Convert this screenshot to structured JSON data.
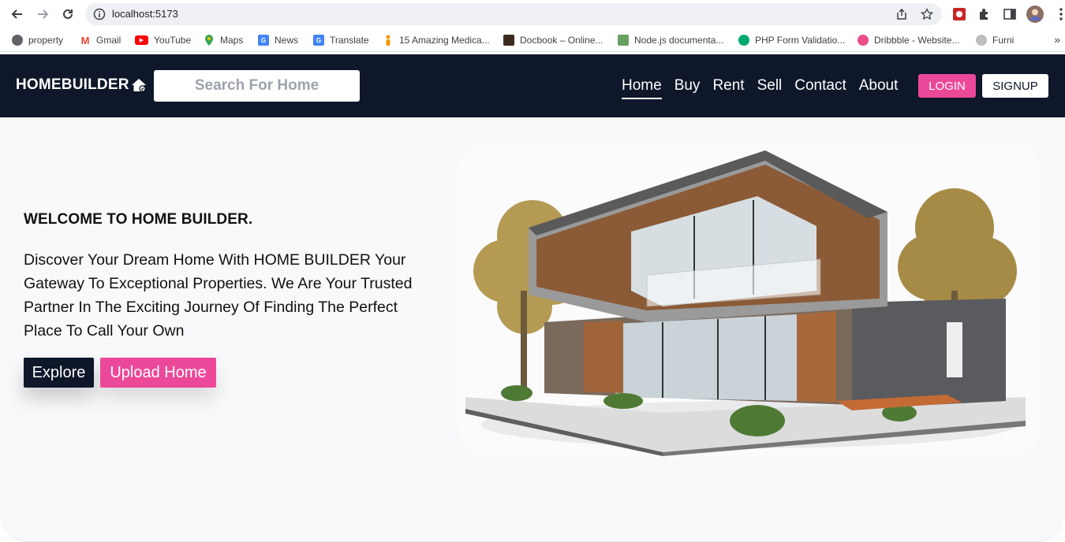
{
  "browser": {
    "url": "localhost:5173",
    "bookmarks": [
      {
        "label": "property",
        "icon": "globe-icon",
        "color": "#5f6368"
      },
      {
        "label": "Gmail",
        "icon": "gmail-icon",
        "color": "#ea4335"
      },
      {
        "label": "YouTube",
        "icon": "youtube-icon",
        "color": "#ff0000"
      },
      {
        "label": "Maps",
        "icon": "maps-icon",
        "color": "#34a853"
      },
      {
        "label": "News",
        "icon": "news-icon",
        "color": "#4285f4"
      },
      {
        "label": "Translate",
        "icon": "translate-icon",
        "color": "#4285f4"
      },
      {
        "label": "15 Amazing Medica...",
        "icon": "person-icon",
        "color": "#f29900"
      },
      {
        "label": "Docbook – Online...",
        "icon": "docbook-icon",
        "color": "#3c2a1e"
      },
      {
        "label": "Node.js documenta...",
        "icon": "nodejs-icon",
        "color": "#689f63"
      },
      {
        "label": "PHP Form Validatio...",
        "icon": "shield-icon",
        "color": "#04aa6d"
      },
      {
        "label": "Dribbble - Website...",
        "icon": "dribbble-icon",
        "color": "#ea4c89"
      },
      {
        "label": "Furni",
        "icon": "furni-icon",
        "color": "#9e9e9e"
      }
    ],
    "more_label": "»"
  },
  "header": {
    "logo_text": "HOMEBUILDER",
    "search_placeholder": "Search For Home",
    "nav": [
      "Home",
      "Buy",
      "Rent",
      "Sell",
      "Contact",
      "About"
    ],
    "active_nav": "Home",
    "login_label": "LOGIN",
    "signup_label": "SIGNUP"
  },
  "hero": {
    "title": "WELCOME TO HOME BUILDER.",
    "description": "Discover Your Dream Home With HOME BUILDER Your Gateway To Exceptional Properties. We Are Your Trusted Partner In The Exciting Journey Of Finding The Perfect Place To Call Your Own",
    "explore_label": "Explore",
    "upload_label": "Upload Home"
  },
  "colors": {
    "header_bg": "#0f172a",
    "accent_pink": "#ec4899",
    "hero_bg": "#f8f9fb"
  }
}
